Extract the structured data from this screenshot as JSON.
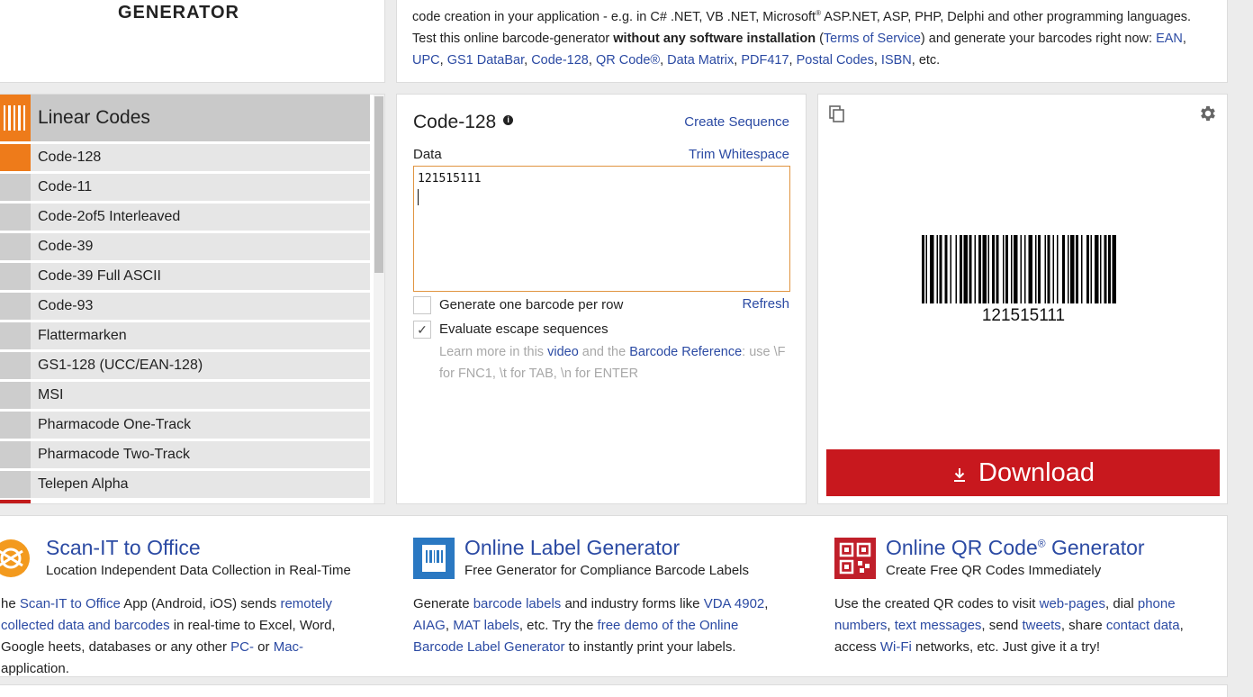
{
  "header": {
    "logo_text": "GENERATOR",
    "intro_line1_a": "code creation in your application - e.g. in C# .NET, VB .NET, Microsoft",
    "intro_line1_sup": "®",
    "intro_line1_b": " ASP.NET, ASP, PHP, Delphi and other programming languages.",
    "intro_line2_a": "Test this online barcode-generator ",
    "intro_line2_bold": "without any software installation",
    "intro_line2_b": " (",
    "terms_link": "Terms of Service",
    "intro_line2_c": ") and generate your barcodes right now: ",
    "links": {
      "ean": "EAN",
      "upc": "UPC",
      "gs1": "GS1 DataBar",
      "code128": "Code-128",
      "qr": "QR Code®",
      "datamatrix": "Data Matrix",
      "pdf417": "PDF417",
      "postal": "Postal Codes",
      "isbn": "ISBN"
    },
    "intro_end": ", etc."
  },
  "sidebar": {
    "title": "Linear Codes",
    "items": [
      {
        "label": "Code-128"
      },
      {
        "label": "Code-11"
      },
      {
        "label": "Code-2of5 Interleaved"
      },
      {
        "label": "Code-39"
      },
      {
        "label": "Code-39 Full ASCII"
      },
      {
        "label": "Code-93"
      },
      {
        "label": "Flattermarken"
      },
      {
        "label": "GS1-128 (UCC/EAN-128)"
      },
      {
        "label": "MSI"
      },
      {
        "label": "Pharmacode One-Track"
      },
      {
        "label": "Pharmacode Two-Track"
      },
      {
        "label": "Telepen Alpha"
      }
    ]
  },
  "editor": {
    "title": "Code-128",
    "create_sequence": "Create Sequence",
    "data_label": "Data",
    "trim_whitespace": "Trim Whitespace",
    "data_value": "121515111",
    "option1_label": "Generate one barcode per row",
    "refresh": "Refresh",
    "option2_label": "Evaluate escape sequences",
    "option2_check": "✓",
    "hint_a": "Learn more in this ",
    "hint_video": "video",
    "hint_b": " and the ",
    "hint_ref": "Barcode Reference",
    "hint_c": ": use \\F for FNC1, \\t for TAB, \\n for ENTER"
  },
  "preview": {
    "barcode_text": "121515111",
    "download_label": "Download"
  },
  "features": [
    {
      "title": "Scan-IT to Office",
      "subtitle": "Location Independent Data Collection in Real-Time",
      "body_a": "he ",
      "link1": "Scan-IT to Office",
      "body_b": " App (Android, iOS) sends ",
      "link2": "remotely collected data and barcodes",
      "body_c": " in real-time to Excel, Word, Google heets, databases or any other ",
      "link3": "PC-",
      "body_d": " or ",
      "link4": "Mac-",
      "body_e": " application."
    },
    {
      "title": "Online Label Generator",
      "subtitle": "Free Generator for Compliance Barcode Labels",
      "body_a": "Generate ",
      "link1": "barcode labels",
      "body_b": " and industry forms like ",
      "link2": "VDA 4902",
      "body_c": ", ",
      "link3": "AIAG",
      "body_d": ", ",
      "link4": "MAT labels",
      "body_e": ", etc. Try the ",
      "link5": "free demo of the Online Barcode Label Generator",
      "body_f": " to instantly print your labels."
    },
    {
      "title": "Online QR Code",
      "title_sup": "®",
      "title_end": " Generator",
      "subtitle": "Create Free QR Codes Immediately",
      "body_a": "Use the created QR codes to visit ",
      "link1": "web-pages",
      "body_b": ", dial ",
      "link2": "phone numbers",
      "body_c": ", ",
      "link3": "text messages",
      "body_d": ", send ",
      "link4": "tweets",
      "body_e": ", share ",
      "link5": "contact data",
      "body_f": ", access ",
      "link6": "Wi-Fi",
      "body_g": " networks, etc. Just give it a try!"
    }
  ],
  "colors": {
    "accent_orange": "#ee7b1a",
    "download_red": "#c8181e",
    "link_blue": "#2b4aa3"
  }
}
